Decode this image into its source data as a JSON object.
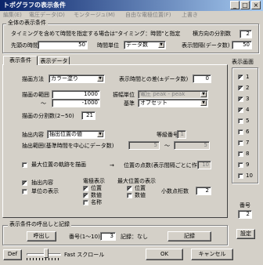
{
  "window": {
    "title": "トポグラフの表示条件",
    "min": "_",
    "max": "□",
    "close": "×"
  },
  "menu": [
    "編集(E)",
    "電圧データ(D)",
    "モンタージュ(M)",
    "自由な電極位置(F)",
    "上書き"
  ],
  "general": {
    "legend": "全体の表示条件",
    "timing_text": "タイミングを含めて時間を指定する場合は\"タイミング：時間\"と指定",
    "divisions_label": "横方向の分割数",
    "divisions_value": "2",
    "start_time_label": "先頭の時間",
    "start_time_value": "50",
    "time_unit_label": "時間単位",
    "time_unit_value": "データ数",
    "display_interval_label": "表示間隔(データ数)",
    "display_interval_value": "50"
  },
  "tabs": {
    "conditions": "表示条件",
    "data": "表示データ"
  },
  "display": {
    "draw_method_label": "描画方法",
    "draw_method_value": "カラー塗り",
    "time_gap_label": "表示時間との差(±データ数)",
    "time_gap_value": "0",
    "range_label": "描画の範囲",
    "range_max": "1000",
    "range_tilde": "〜",
    "range_min": "-1000",
    "mode_unit_label": "振幅単位",
    "mode_unit_value": "電圧 peak - peak",
    "baseline_label": "基準",
    "baseline_value": "オフセット",
    "split_label": "描画の分割数(2~50)",
    "split_value": "21",
    "extract_label": "抽出内容",
    "extract_value": "抽出位置の値",
    "wave_num_label": "等級番号",
    "wave_num_value": "1",
    "extract_pos_label": "抽出範囲(基準時間を中心にデータ数)",
    "extract_from": "5",
    "extract_tilde": "〜",
    "extract_to": "5",
    "max_track_label": "最大位置の軌跡を描画",
    "arrow": "→",
    "pos_count_label": "位置の点数(表示間隔ごとに作成)",
    "pos_count_value": "10"
  },
  "options": {
    "extract_content": "抽出内容",
    "unit_display": "単位の表示",
    "electrode_legend": "電極表示",
    "electrode": [
      {
        "label": "位置",
        "checked": true
      },
      {
        "label": "数値",
        "checked": true
      },
      {
        "label": "名称",
        "checked": false
      }
    ],
    "maxpos_legend": "最大位置の表示",
    "maxpos": [
      {
        "label": "位置",
        "checked": true
      },
      {
        "label": "数値",
        "checked": false
      }
    ],
    "decimals_label": "小数点桁数",
    "decimals_value": "2"
  },
  "screens": {
    "legend": "表示画面",
    "items": [
      {
        "label": "1",
        "checked": true
      },
      {
        "label": "2",
        "checked": true
      },
      {
        "label": "3",
        "checked": true
      },
      {
        "label": "4",
        "checked": true
      },
      {
        "label": "5",
        "checked": false
      },
      {
        "label": "6",
        "checked": false
      },
      {
        "label": "7",
        "checked": false
      },
      {
        "label": "8",
        "checked": false
      },
      {
        "label": "9",
        "checked": false
      },
      {
        "label": "10",
        "checked": false
      }
    ],
    "number_label": "番号",
    "number_value": "2",
    "set_button": "設定"
  },
  "recall": {
    "legend": "表示条件の呼出しと記録",
    "recall_button": "呼出し",
    "number_label": "番号(1〜10)",
    "number_value": "3",
    "record_status": "記録：なし",
    "record_button": "記録"
  },
  "footer": {
    "def_button": "Def",
    "slider_label": "Fast スクロール",
    "ok_button": "OK",
    "cancel_button": "キャンセル"
  }
}
